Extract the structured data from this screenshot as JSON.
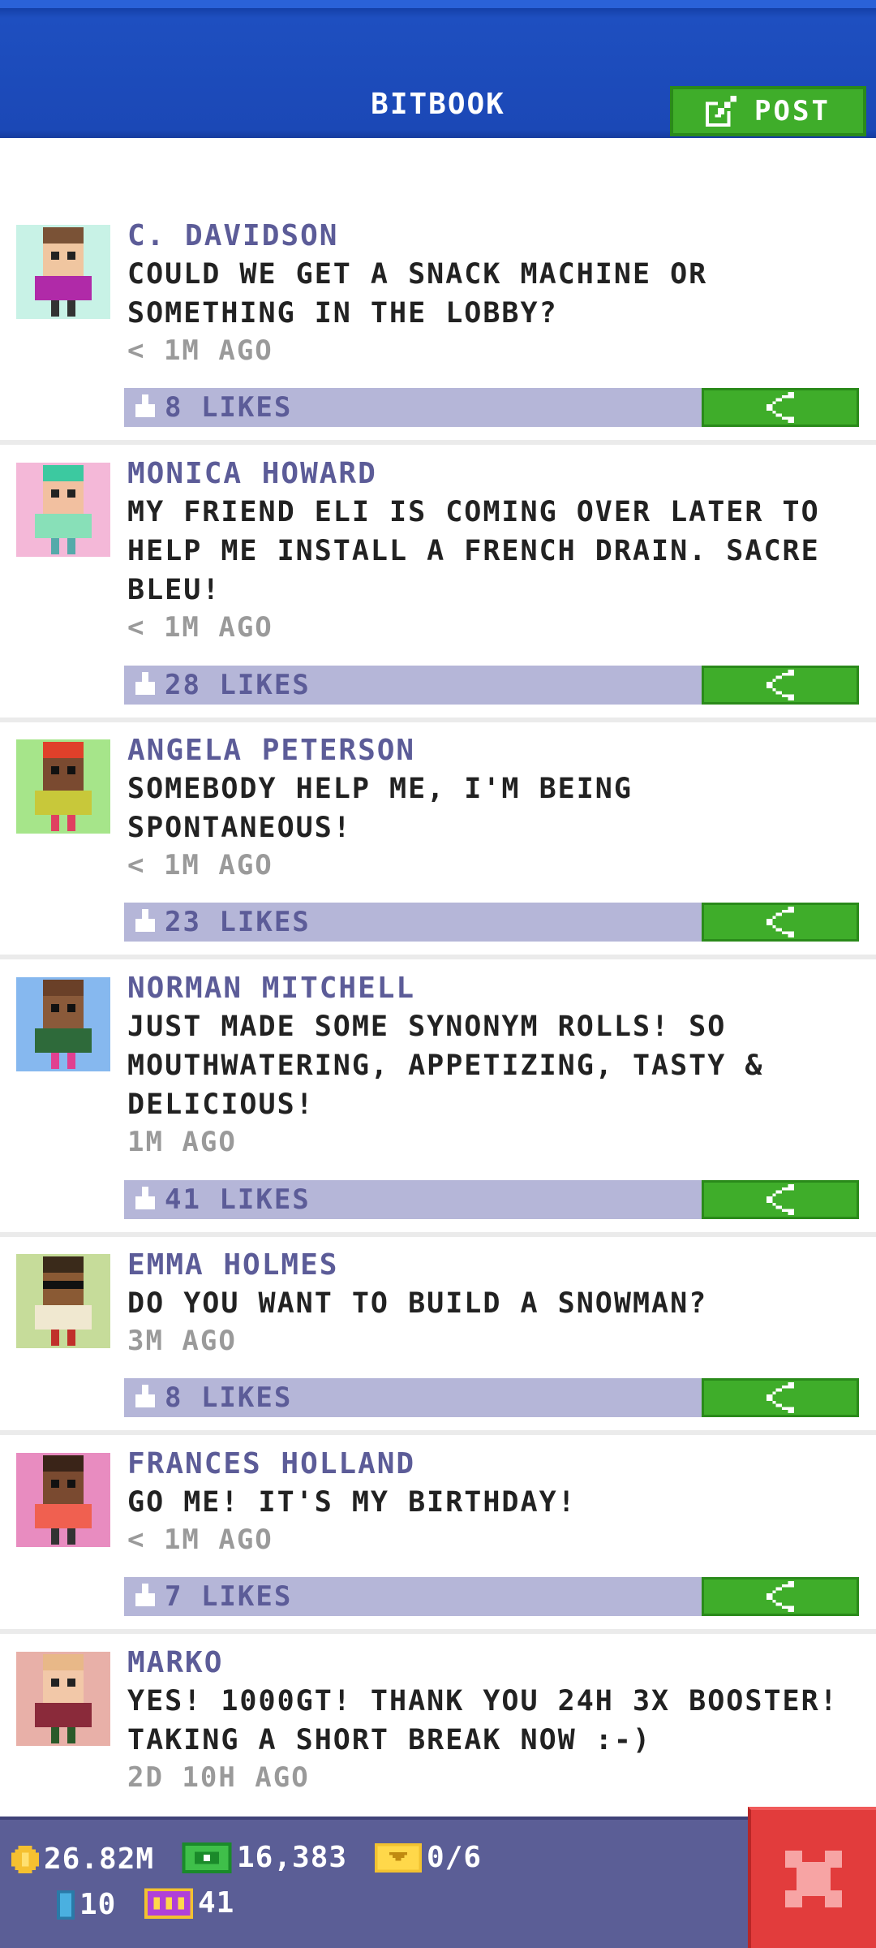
{
  "header": {
    "title": "BITBOOK",
    "post_label": "POST"
  },
  "colors": {
    "header_blue": "#1b48b6",
    "accent_green": "#3fad2a",
    "likes_bar": "#b5b6d8",
    "name_purple": "#5c5c98",
    "status_bar": "#5b5e96",
    "close_red": "#e23c3c"
  },
  "posts": [
    {
      "name": "C. DAVIDSON",
      "message": "COULD WE GET A SNACK MACHINE OR\nSOMETHING IN THE LOBBY?",
      "time": "< 1M AGO",
      "likes": "8 LIKES",
      "avatar_bg": "#c8f2e6"
    },
    {
      "name": "MONICA HOWARD",
      "message": "MY FRIEND ELI IS COMING OVER LATER TO\nHELP ME INSTALL A FRENCH DRAIN. SACRE\nBLEU!",
      "time": "< 1M AGO",
      "likes": "28 LIKES",
      "avatar_bg": "#f4b8d8"
    },
    {
      "name": "ANGELA PETERSON",
      "message": "SOMEBODY HELP ME, I'M BEING\nSPONTANEOUS!",
      "time": "< 1M AGO",
      "likes": "23 LIKES",
      "avatar_bg": "#a6e58a"
    },
    {
      "name": "NORMAN MITCHELL",
      "message": "JUST MADE SOME SYNONYM ROLLS! SO\nMOUTHWATERING, APPETIZING, TASTY &\nDELICIOUS!",
      "time": "1M AGO",
      "likes": "41 LIKES",
      "avatar_bg": "#86b8ef"
    },
    {
      "name": "EMMA HOLMES",
      "message": "DO YOU WANT TO BUILD A SNOWMAN?",
      "time": "3M AGO",
      "likes": "8 LIKES",
      "avatar_bg": "#c6dc9a"
    },
    {
      "name": "FRANCES HOLLAND",
      "message": "GO ME! IT'S MY BIRTHDAY!",
      "time": "< 1M AGO",
      "likes": "7 LIKES",
      "avatar_bg": "#e88cc0"
    },
    {
      "name": "MARKO",
      "message": "YES! 1000GT! THANK YOU 24H 3X BOOSTER!\nTAKING A SHORT BREAK NOW :-)",
      "time": "2D 10H AGO",
      "likes": "",
      "avatar_bg": "#e8b0a8"
    }
  ],
  "status_bar": {
    "coins": "26.82M",
    "bux": "16,383",
    "tickets": "0/6",
    "keys": "10",
    "vip": "41"
  }
}
